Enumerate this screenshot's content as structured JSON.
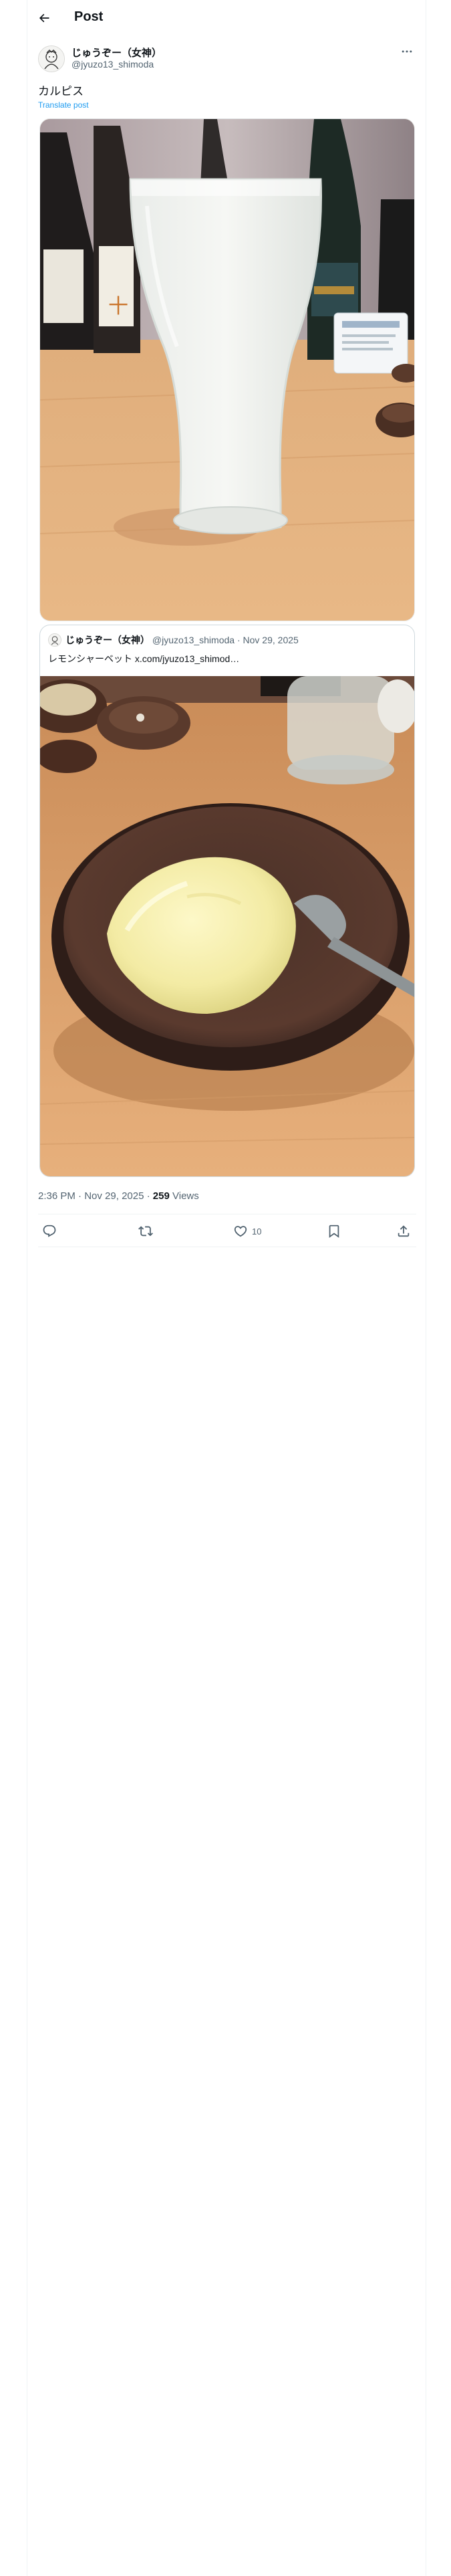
{
  "header": {
    "title": "Post"
  },
  "post": {
    "author": {
      "display_name": "じゅうぞー（女神）",
      "handle": "@jyuzo13_shimoda"
    },
    "text": "カルピス",
    "translate_label": "Translate post",
    "media_description_icon": "photo-glass-calpis",
    "quoted": {
      "display_name": "じゅうぞー（女神）",
      "handle": "@jyuzo13_shimoda",
      "separator": "·",
      "date": "Nov 29, 2025",
      "text": "レモンシャーベット x.com/jyuzo13_shimod…",
      "media_description_icon": "photo-lemon-sherbet"
    },
    "meta": {
      "time": "2:36 PM",
      "separator": "·",
      "date": "Nov 29, 2025",
      "views_count": "259",
      "views_label": "Views"
    },
    "actions": {
      "reply_count": "",
      "repost_count": "",
      "like_count": "10",
      "bookmark_count": ""
    }
  },
  "colors": {
    "accent": "#1d9bf0",
    "text_primary": "#0f1419",
    "text_secondary": "#536471",
    "border": "#eff3f4"
  }
}
